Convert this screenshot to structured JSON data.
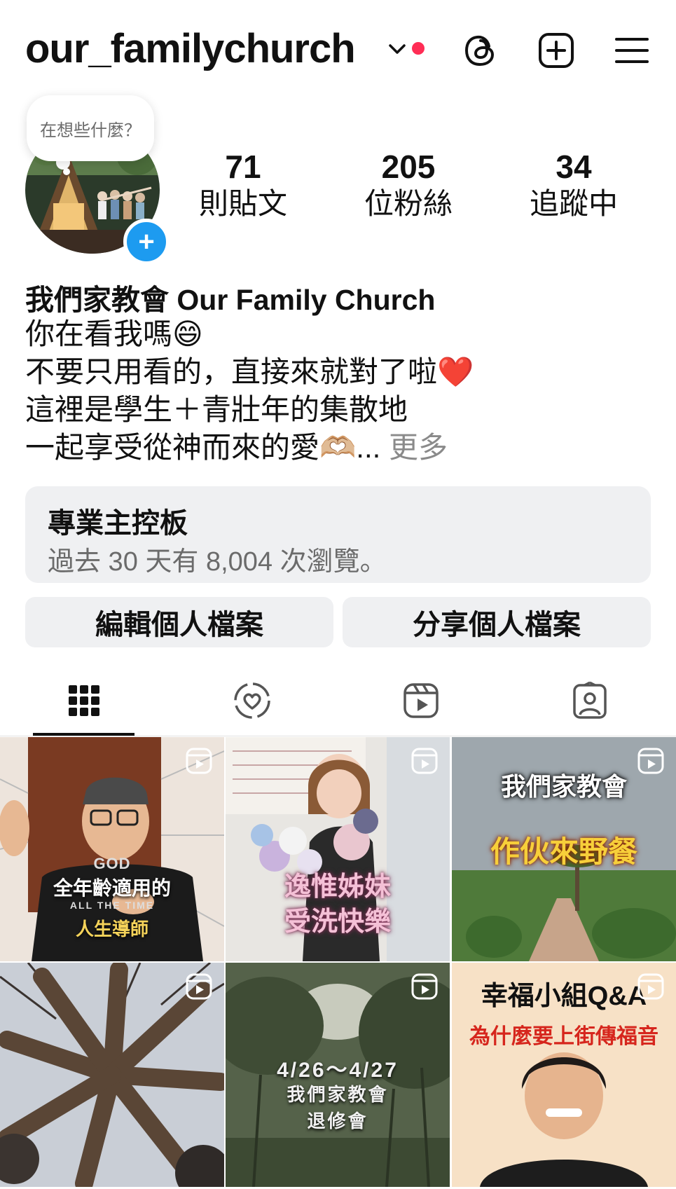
{
  "header": {
    "username": "our_familychurch",
    "icons": [
      "chevron-down-icon",
      "threads-icon",
      "create-icon",
      "menu-icon"
    ],
    "notification_dot_color": "#ff2d55"
  },
  "note": {
    "text": "在想些什麼？"
  },
  "stats": [
    {
      "value": "71",
      "label": "則貼文"
    },
    {
      "value": "205",
      "label": "位粉絲"
    },
    {
      "value": "34",
      "label": "追蹤中"
    }
  ],
  "bio": {
    "name": "我們家教會 Our Family Church",
    "lines": [
      "你在看我嗎😄",
      "不要只用看的，直接來就對了啦❤️",
      "這裡是學生＋青壯年的集散地",
      "一起享受從神而來的愛🫶🏼..."
    ],
    "more": " 更多"
  },
  "dashboard": {
    "title": "專業主控板",
    "subtitle": "過去 30 天有 8,004 次瀏覽。"
  },
  "actions": {
    "edit": "編輯個人檔案",
    "share": "分享個人檔案"
  },
  "tabs": [
    "grid-icon",
    "heart-collab-icon",
    "reels-icon",
    "tagged-icon"
  ],
  "grid": [
    {
      "caption_lines": [
        "全年齡適用的",
        "人生導師"
      ],
      "shirt_text": "GOD",
      "shirt_sub": "ALL THE TIME"
    },
    {
      "caption_lines": [
        "逸惟姊妹",
        "受洗快樂"
      ]
    },
    {
      "caption_lines": [
        "我們家教會",
        "作伙來野餐"
      ]
    },
    {
      "caption_lines": []
    },
    {
      "caption_lines": [
        "4/26～4/27",
        "我們家教會",
        "退修會"
      ]
    },
    {
      "caption_lines": [
        "幸福小組Q&A",
        "為什麼要上街傳福音"
      ]
    }
  ]
}
